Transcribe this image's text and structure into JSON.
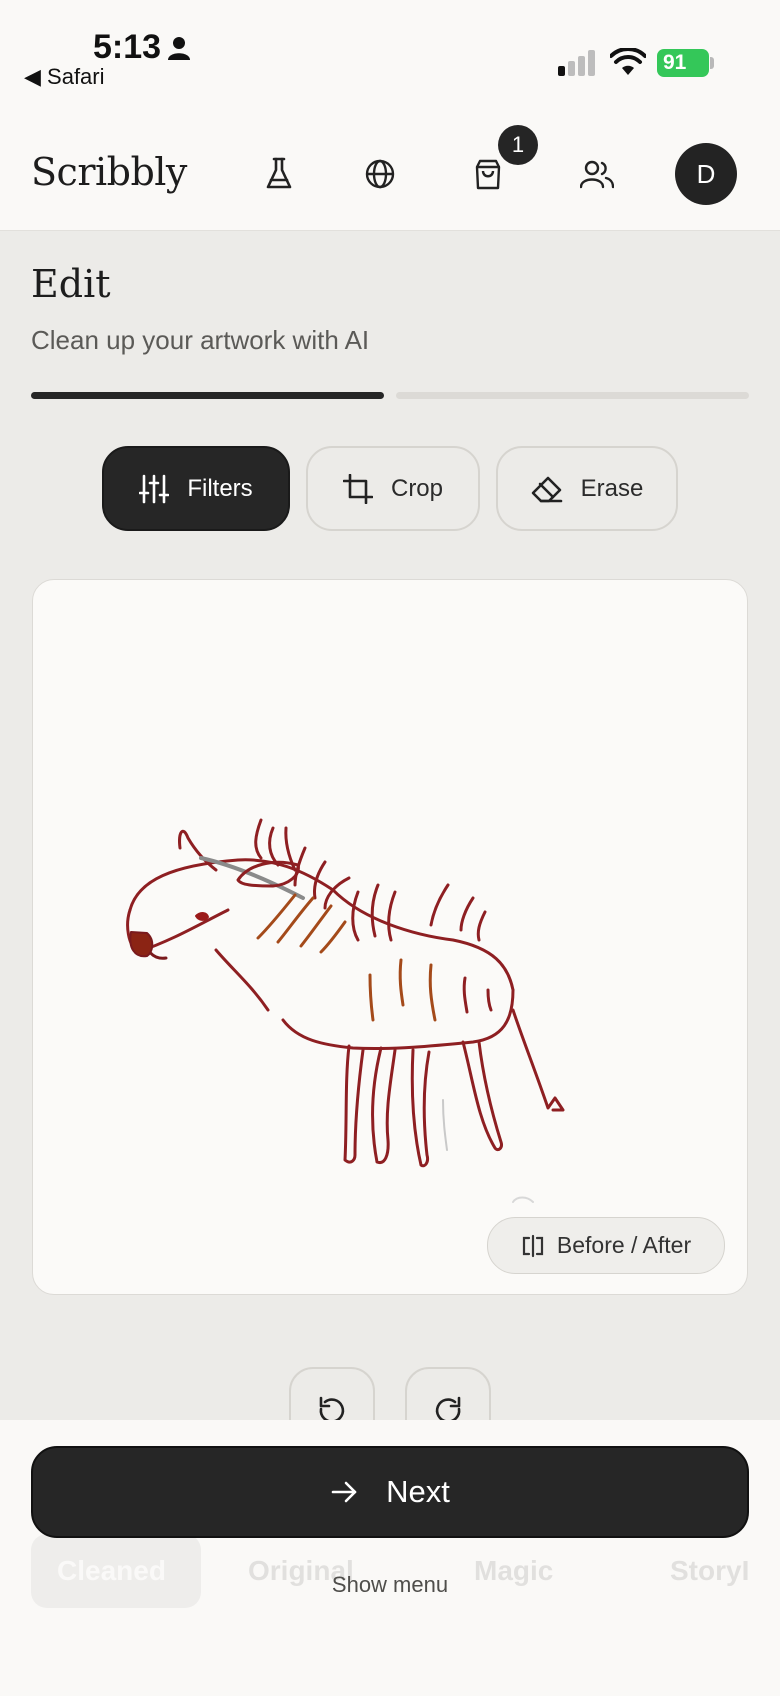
{
  "status_bar": {
    "time": "5:13",
    "back_app": "◀ Safari",
    "battery": "91"
  },
  "header": {
    "brand": "Scribbly",
    "cart_count": "1",
    "avatar_initial": "D",
    "icons": [
      "flask-icon",
      "globe-icon",
      "shopping-bag-icon",
      "users-icon"
    ]
  },
  "page": {
    "title": "Edit",
    "subtitle": "Clean up your artwork with AI",
    "progress": {
      "completed_fraction": 0.5
    }
  },
  "tools": {
    "filters": "Filters",
    "crop": "Crop",
    "erase": "Erase",
    "active": "filters"
  },
  "canvas": {
    "before_after_label": "Before / After"
  },
  "history": {
    "undo_icon": "undo-icon",
    "redo_icon": "redo-icon"
  },
  "footer": {
    "next_label": "Next",
    "show_menu_label": "Show menu",
    "menu_items": [
      "Cleaned",
      "Original",
      "Magic",
      "StoryI"
    ]
  },
  "colors": {
    "primary": "#262626",
    "background": "#ecebe8",
    "surface": "#faf9f7",
    "battery": "#34c759"
  }
}
